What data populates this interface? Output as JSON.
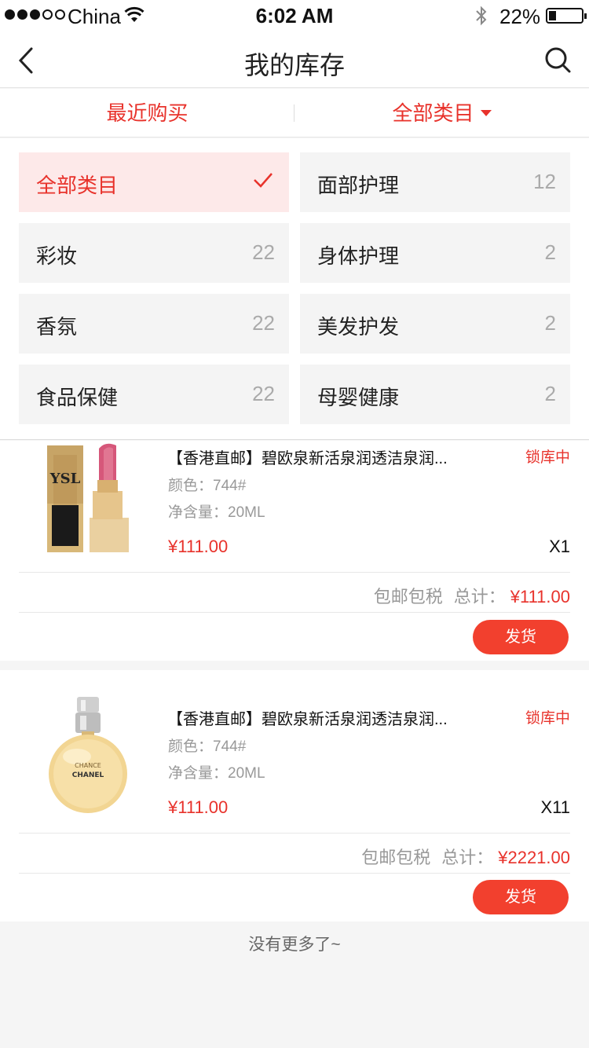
{
  "status_bar": {
    "carrier": "China",
    "time": "6:02 AM",
    "battery": "22%"
  },
  "nav": {
    "title": "我的库存"
  },
  "filter": {
    "recent": "最近购买",
    "all": "全部类目"
  },
  "categories": [
    {
      "name": "全部类目",
      "count": "",
      "active": true
    },
    {
      "name": "面部护理",
      "count": "12"
    },
    {
      "name": "彩妆",
      "count": "22"
    },
    {
      "name": "身体护理",
      "count": "2"
    },
    {
      "name": "香氛",
      "count": "22"
    },
    {
      "name": "美发护发",
      "count": "2"
    },
    {
      "name": "食品保健",
      "count": "22"
    },
    {
      "name": "母婴健康",
      "count": "2"
    }
  ],
  "products": [
    {
      "name": "【香港直邮】碧欧泉新活泉润透洁泉润...",
      "status": "锁库中",
      "color": "颜色：744#",
      "volume": "净含量：20ML",
      "price": "¥111.00",
      "qty": "X1",
      "shipping": "包邮包税",
      "total_label": "总计：",
      "total": "¥111.00",
      "button": "发货",
      "image": "lipstick"
    },
    {
      "name": "【香港直邮】碧欧泉新活泉润透洁泉润...",
      "status": "锁库中",
      "color": "颜色：744#",
      "volume": "净含量：20ML",
      "price": "¥111.00",
      "qty": "X11",
      "shipping": "包邮包税",
      "total_label": "总计：",
      "total": "¥2221.00",
      "button": "发货",
      "image": "perfume",
      "image_text": [
        "CHANCE",
        "CHANEL"
      ]
    }
  ],
  "footer": "没有更多了~",
  "colors": {
    "accent": "#e8322b",
    "button": "#f2402e",
    "active_category_bg": "#fde9e9"
  }
}
